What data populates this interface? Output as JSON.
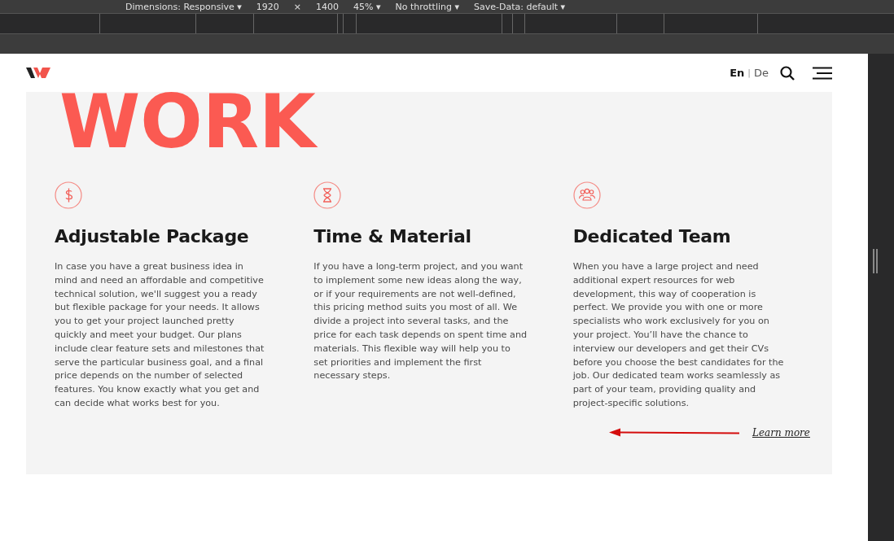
{
  "devtools": {
    "toolbar_items": [
      "Dimensions: Responsive ▾",
      "1920",
      "×",
      "1400",
      "45% ▾",
      "No throttling ▾",
      "Save-Data: default ▾"
    ]
  },
  "header": {
    "languages": [
      {
        "label": "En",
        "selected": true
      },
      {
        "label": "De",
        "selected": false
      }
    ],
    "language_separator": "|"
  },
  "section": {
    "heading": "WORK",
    "services": [
      {
        "kind": "dollar",
        "title": "Adjustable Package",
        "text": "In case you have a great business idea in mind and need an affordable and competitive technical solution, we'll suggest you a ready but flexible package for your needs. It allows you to get your project launched pretty quickly and meet your budget. Our plans include clear feature sets and milestones that serve the particular business goal, and a final price depends on the number of selected features. You know exactly what you get and can decide what works best for you."
      },
      {
        "kind": "hourglass",
        "title": "Time & Material",
        "text": "If you have a long-term project, and you want to implement some new ideas along the way, or if your requirements are not well-defined, this pricing method suits you most of all. We divide a project into several tasks, and the price for each task depends on spent time and materials. This flexible way will help you to set priorities and implement the first necessary steps."
      },
      {
        "kind": "team",
        "title": "Dedicated Team",
        "text": "When you have a large project and need additional expert resources for web development, this way of cooperation is perfect. We provide you with one or more specialists who work exclusively for you on your project. You’ll have the chance to interview our developers and get their CVs before you choose the best candidates for the job. Our dedicated team works seamlessly as part of your team, providing quality and project-specific solutions."
      }
    ],
    "learn_more": "Learn more"
  }
}
